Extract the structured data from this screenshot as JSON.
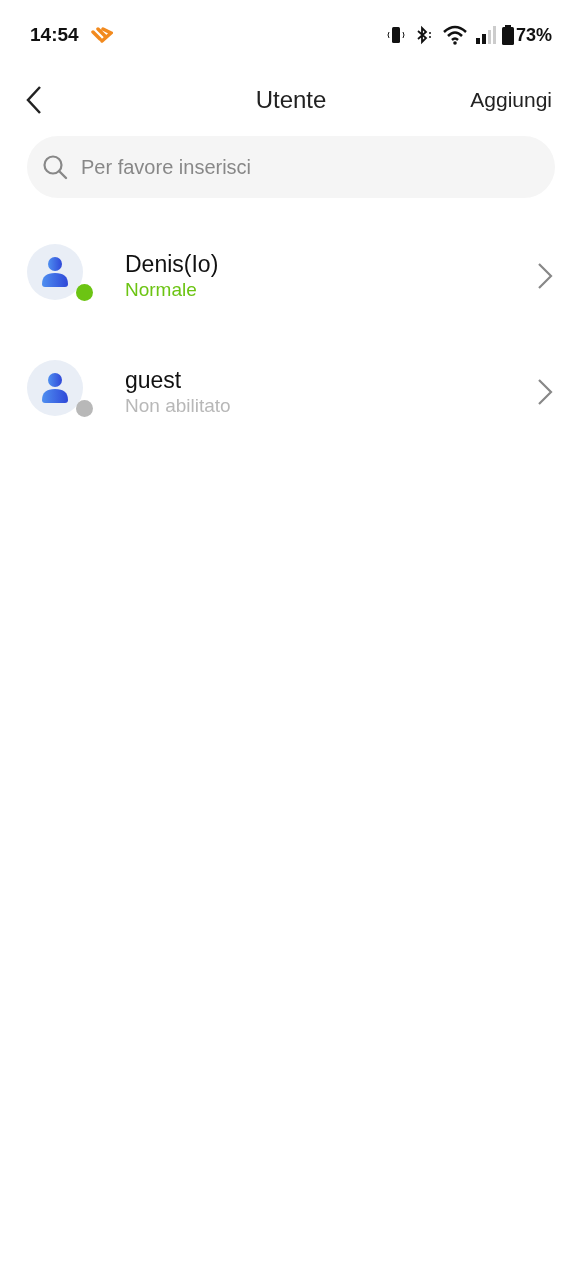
{
  "status_bar": {
    "time": "14:54",
    "battery": "73%"
  },
  "header": {
    "title": "Utente",
    "action": "Aggiungi"
  },
  "search": {
    "placeholder": "Per favore inserisci"
  },
  "users": [
    {
      "name": "Denis(Io)",
      "status": "Normale",
      "color": "#6cc413"
    },
    {
      "name": "guest",
      "status": "Non abilitato",
      "color": "#b8b8b8"
    }
  ]
}
